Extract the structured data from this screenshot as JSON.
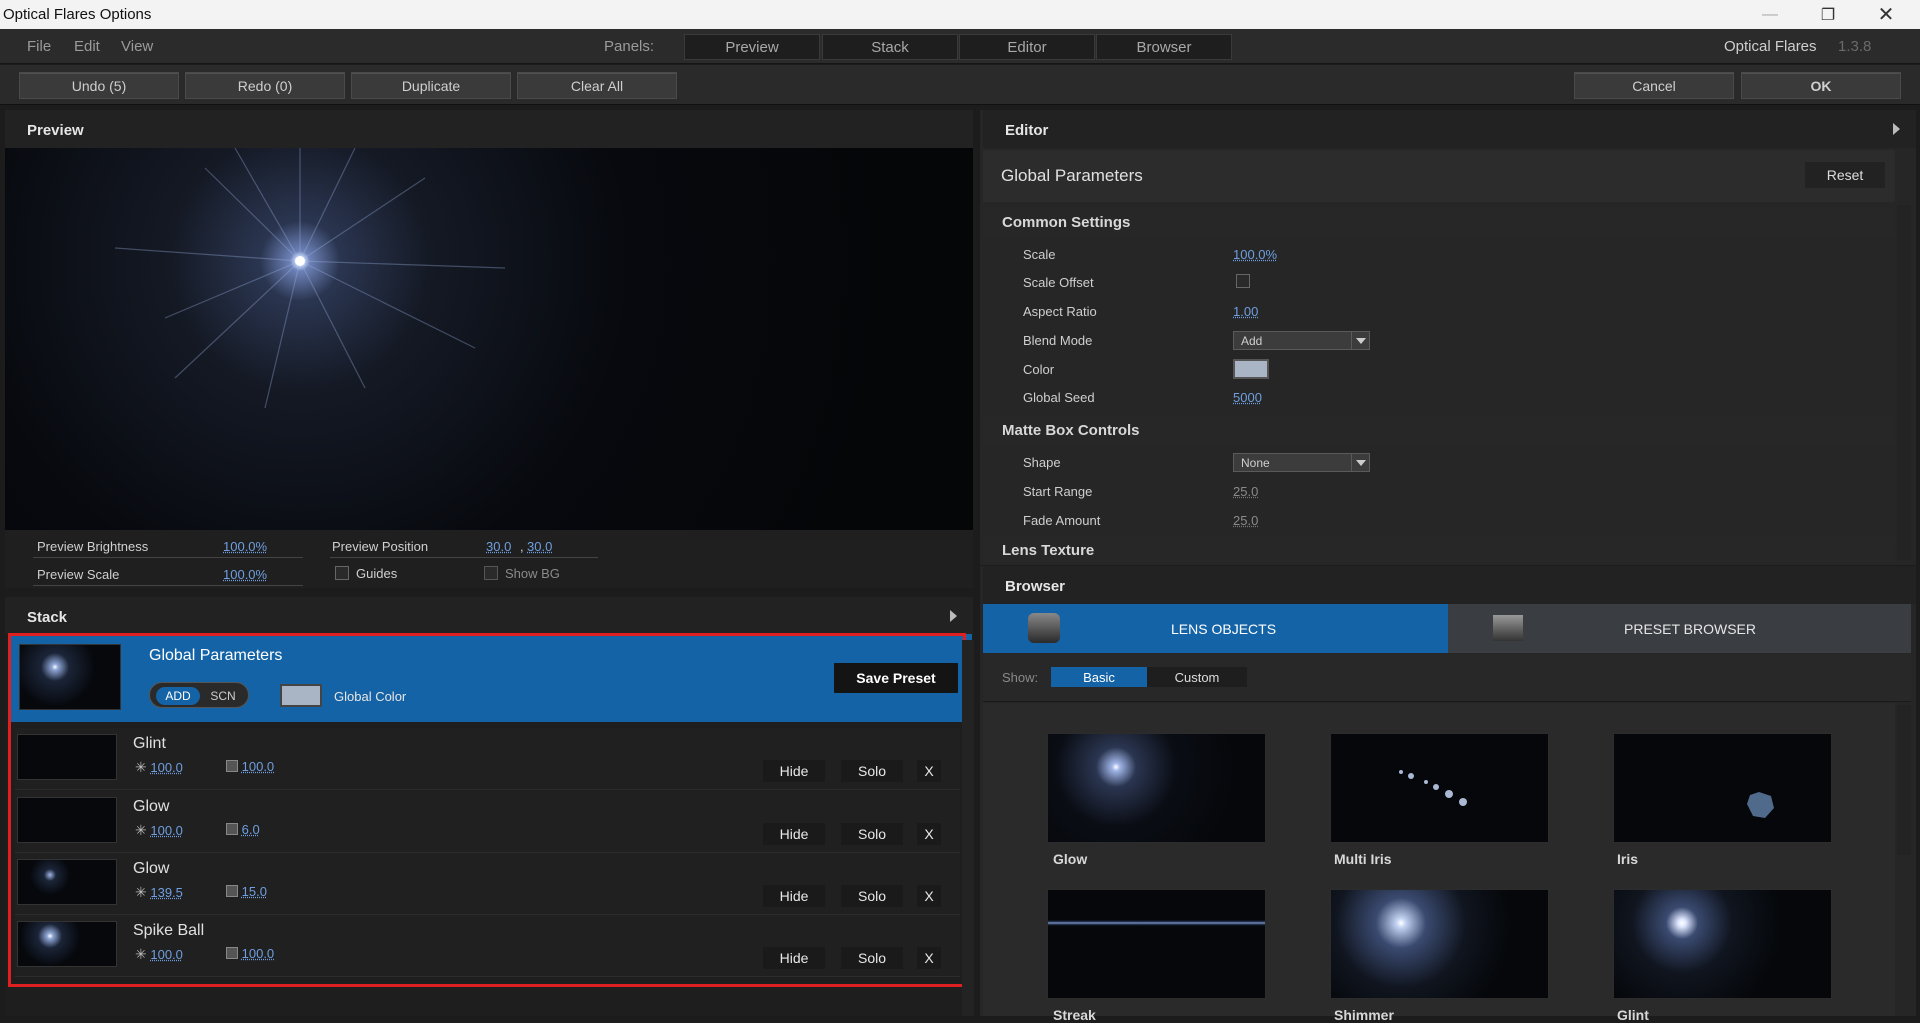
{
  "window": {
    "title": "Optical Flares Options"
  },
  "menu": {
    "file": "File",
    "edit": "Edit",
    "view": "View",
    "panels_label": "Panels:",
    "panels": [
      "Preview",
      "Stack",
      "Editor",
      "Browser"
    ],
    "app_name": "Optical Flares",
    "version": "1.3.8"
  },
  "toolbar": {
    "undo": "Undo (5)",
    "redo": "Redo (0)",
    "duplicate": "Duplicate",
    "clear_all": "Clear All",
    "cancel": "Cancel",
    "ok": "OK"
  },
  "preview": {
    "title": "Preview",
    "brightness_label": "Preview Brightness",
    "brightness": "100.0%",
    "scale_label": "Preview Scale",
    "scale": "100.0%",
    "position_label": "Preview Position",
    "position_x": "30.0",
    "position_sep": ",",
    "position_y": "30.0",
    "guides_label": "Guides",
    "show_bg_label": "Show BG"
  },
  "stack": {
    "title": "Stack",
    "global": {
      "name": "Global Parameters",
      "add": "ADD",
      "scn": "SCN",
      "color_label": "Global Color",
      "save_preset": "Save Preset"
    },
    "rows": [
      {
        "name": "Glint",
        "brightness": "100.0",
        "scale": "100.0"
      },
      {
        "name": "Glow",
        "brightness": "100.0",
        "scale": "6.0"
      },
      {
        "name": "Glow",
        "brightness": "139.5",
        "scale": "15.0"
      },
      {
        "name": "Spike Ball",
        "brightness": "100.0",
        "scale": "100.0"
      }
    ],
    "hide": "Hide",
    "solo": "Solo",
    "remove": "X"
  },
  "editor": {
    "title": "Editor",
    "section_title": "Global Parameters",
    "reset": "Reset",
    "common": "Common Settings",
    "scale_label": "Scale",
    "scale": "100.0%",
    "scale_offset_label": "Scale Offset",
    "aspect_label": "Aspect Ratio",
    "aspect": "1.00",
    "blend_label": "Blend Mode",
    "blend": "Add",
    "color_label": "Color",
    "seed_label": "Global Seed",
    "seed": "5000",
    "matte": "Matte Box Controls",
    "shape_label": "Shape",
    "shape": "None",
    "start_label": "Start Range",
    "start": "25.0",
    "fade_label": "Fade Amount",
    "fade": "25.0",
    "lens_texture": "Lens Texture"
  },
  "browser": {
    "title": "Browser",
    "tab_lens": "LENS OBJECTS",
    "tab_preset": "PRESET BROWSER",
    "show_label": "Show:",
    "basic": "Basic",
    "custom": "Custom",
    "tiles": [
      "Glow",
      "Multi Iris",
      "Iris",
      "Streak",
      "Shimmer",
      "Glint"
    ]
  },
  "colors": {
    "accent": "#1463a6",
    "value": "#6f9fe0",
    "highlight_border": "#e02020"
  }
}
